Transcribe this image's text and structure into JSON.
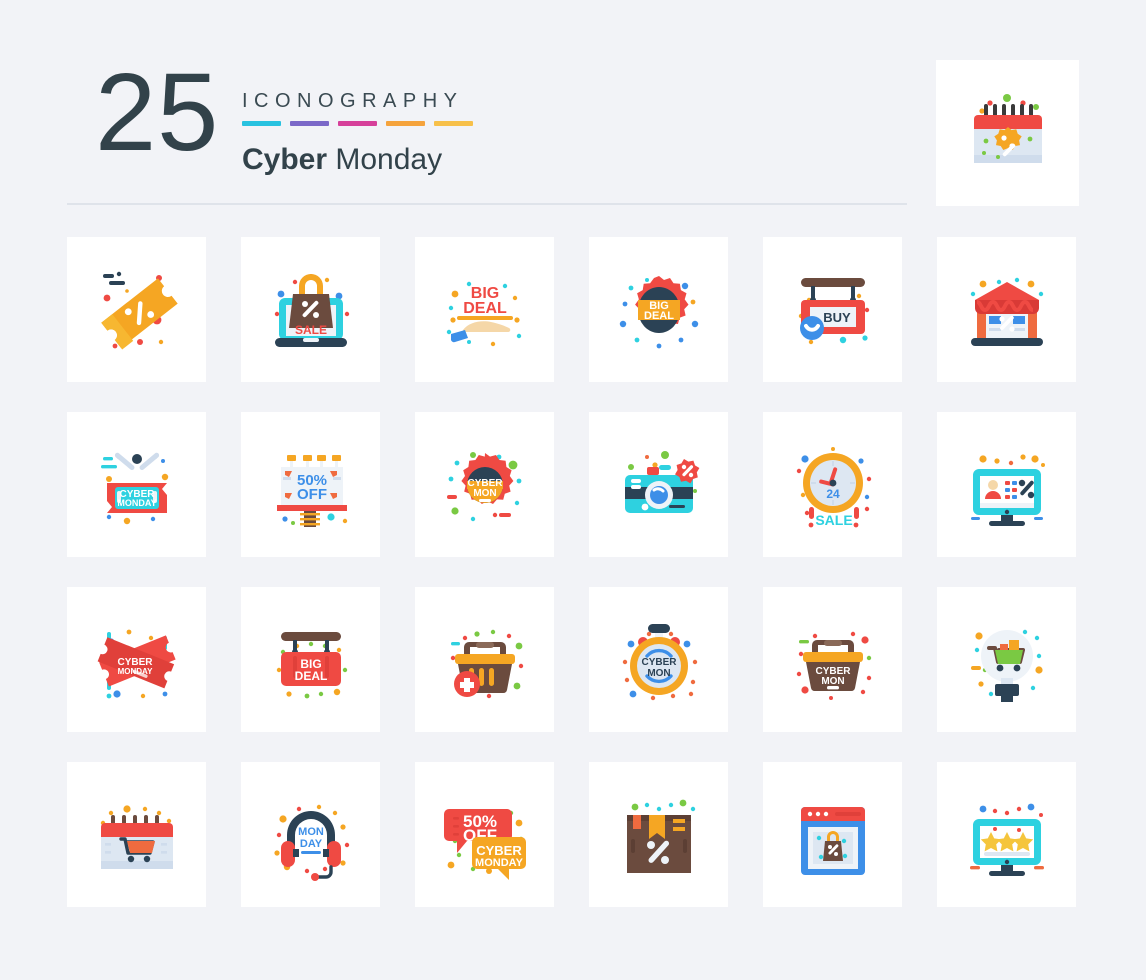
{
  "header": {
    "count": "25",
    "kicker": "ICONOGRAPHY",
    "title_bold": "Cyber",
    "title_light": " Monday",
    "bar_colors": [
      "#29c2e0",
      "#7b68c8",
      "#d6409a",
      "#f5a33c",
      "#f7c04a"
    ]
  },
  "palette": {
    "background": "#f2f3f7",
    "card": "#ffffff",
    "divider": "#dfe3ea",
    "ink": "#32424a",
    "red": "#ef4a43",
    "red_dark": "#e0403a",
    "orange": "#f5a623",
    "yellow": "#f7b731",
    "cyan": "#2ed1e0",
    "blue": "#3d8fe8",
    "navy": "#2b4255",
    "brown": "#6b4b3e",
    "brown_dark": "#5c3f34",
    "green": "#7ac943",
    "light_blue": "#dde7f2",
    "skin": "#f5d7a8"
  },
  "featured_icon": {
    "name": "calendar-discount-icon",
    "label": "Calendar with discount badge"
  },
  "icons": [
    {
      "name": "discount-ticket-icon",
      "label": "Discount ticket"
    },
    {
      "name": "laptop-sale-bag-icon",
      "label": "Laptop sale shopping bag",
      "text": "SALE"
    },
    {
      "name": "big-deal-hand-icon",
      "label": "Big deal in hand",
      "text": "BIG DEAL"
    },
    {
      "name": "big-deal-badge-icon",
      "label": "Big deal badge",
      "text": "BIG DEAL"
    },
    {
      "name": "buy-hanging-sign-icon",
      "label": "Buy hanging sign",
      "text": "BUY"
    },
    {
      "name": "shop-discount-icon",
      "label": "Discount shop storefront"
    },
    {
      "name": "cyber-monday-sign-icon",
      "label": "Cyber Monday sign",
      "text": "CYBER MONDAY"
    },
    {
      "name": "fifty-percent-billboard-icon",
      "label": "50% off billboard",
      "text": "50% OFF"
    },
    {
      "name": "cyber-mon-badge-icon",
      "label": "Cyber Mon badge",
      "text": "CYBER MON"
    },
    {
      "name": "camera-discount-icon",
      "label": "Camera with discount badge"
    },
    {
      "name": "twentyfour-hour-sale-clock-icon",
      "label": "24 hour sale clock",
      "text": "24 SALE"
    },
    {
      "name": "monitor-user-discount-icon",
      "label": "Monitor with user and discount"
    },
    {
      "name": "cyber-monday-tickets-icon",
      "label": "Cyber Monday tickets",
      "text": "CYBER MONDAY"
    },
    {
      "name": "big-deal-hanging-sign-icon",
      "label": "Big deal hanging sign",
      "text": "BIG DEAL"
    },
    {
      "name": "add-to-basket-icon",
      "label": "Add to shopping basket"
    },
    {
      "name": "cyber-mon-stopwatch-icon",
      "label": "Cyber Mon stopwatch",
      "text": "CYBER MON"
    },
    {
      "name": "cyber-mon-basket-icon",
      "label": "Cyber Mon basket",
      "text": "CYBER MON"
    },
    {
      "name": "shopping-idea-bulb-icon",
      "label": "Shopping cart idea bulb"
    },
    {
      "name": "calendar-cart-icon",
      "label": "Calendar with shopping cart"
    },
    {
      "name": "monday-headphones-icon",
      "label": "Monday support headphones",
      "text": "MON DAY"
    },
    {
      "name": "fifty-percent-chat-icon",
      "label": "50% off cyber monday chat",
      "text": "50% OFF CYBER MONDAY"
    },
    {
      "name": "discount-package-icon",
      "label": "Discount package box"
    },
    {
      "name": "browser-shopping-bag-icon",
      "label": "Browser with shopping bag"
    },
    {
      "name": "monitor-rating-stars-icon",
      "label": "Monitor with rating stars"
    }
  ]
}
